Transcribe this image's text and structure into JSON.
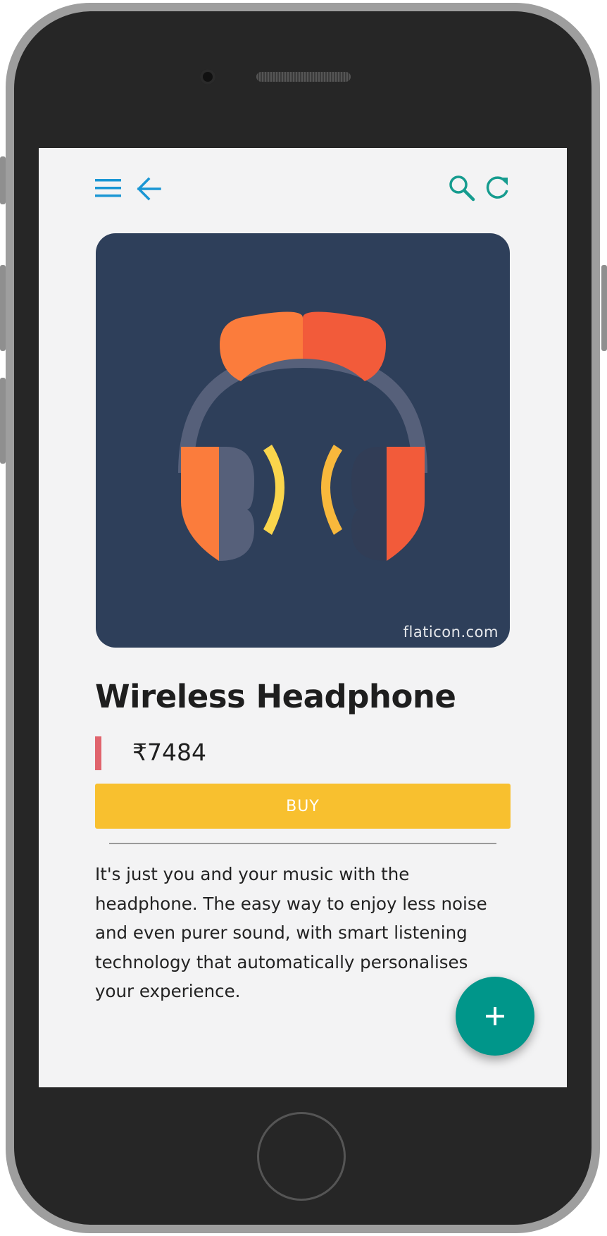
{
  "toolbar": {
    "menu_icon": "menu-icon",
    "back_icon": "arrow-left-icon",
    "search_icon": "search-icon",
    "refresh_icon": "refresh-icon",
    "left_icon_color": "#1a96d4",
    "right_icon_color": "#169c8f"
  },
  "product": {
    "image_icon": "headphones-icon",
    "image_background": "#2e3f5a",
    "watermark": "flaticon.com",
    "title": "Wireless Headphone",
    "price": "₹7484",
    "buy_label": "BUY",
    "description": "It's just you and your music with the headphone. The easy way to enjoy less noise and even purer sound, with smart listening technology that automatically personalises your experience."
  },
  "fab": {
    "icon": "plus-icon",
    "color": "#00968a"
  },
  "colors": {
    "accent_buy": "#f8c02f",
    "price_marker": "#e0646d",
    "screen_bg": "#f3f3f4"
  }
}
